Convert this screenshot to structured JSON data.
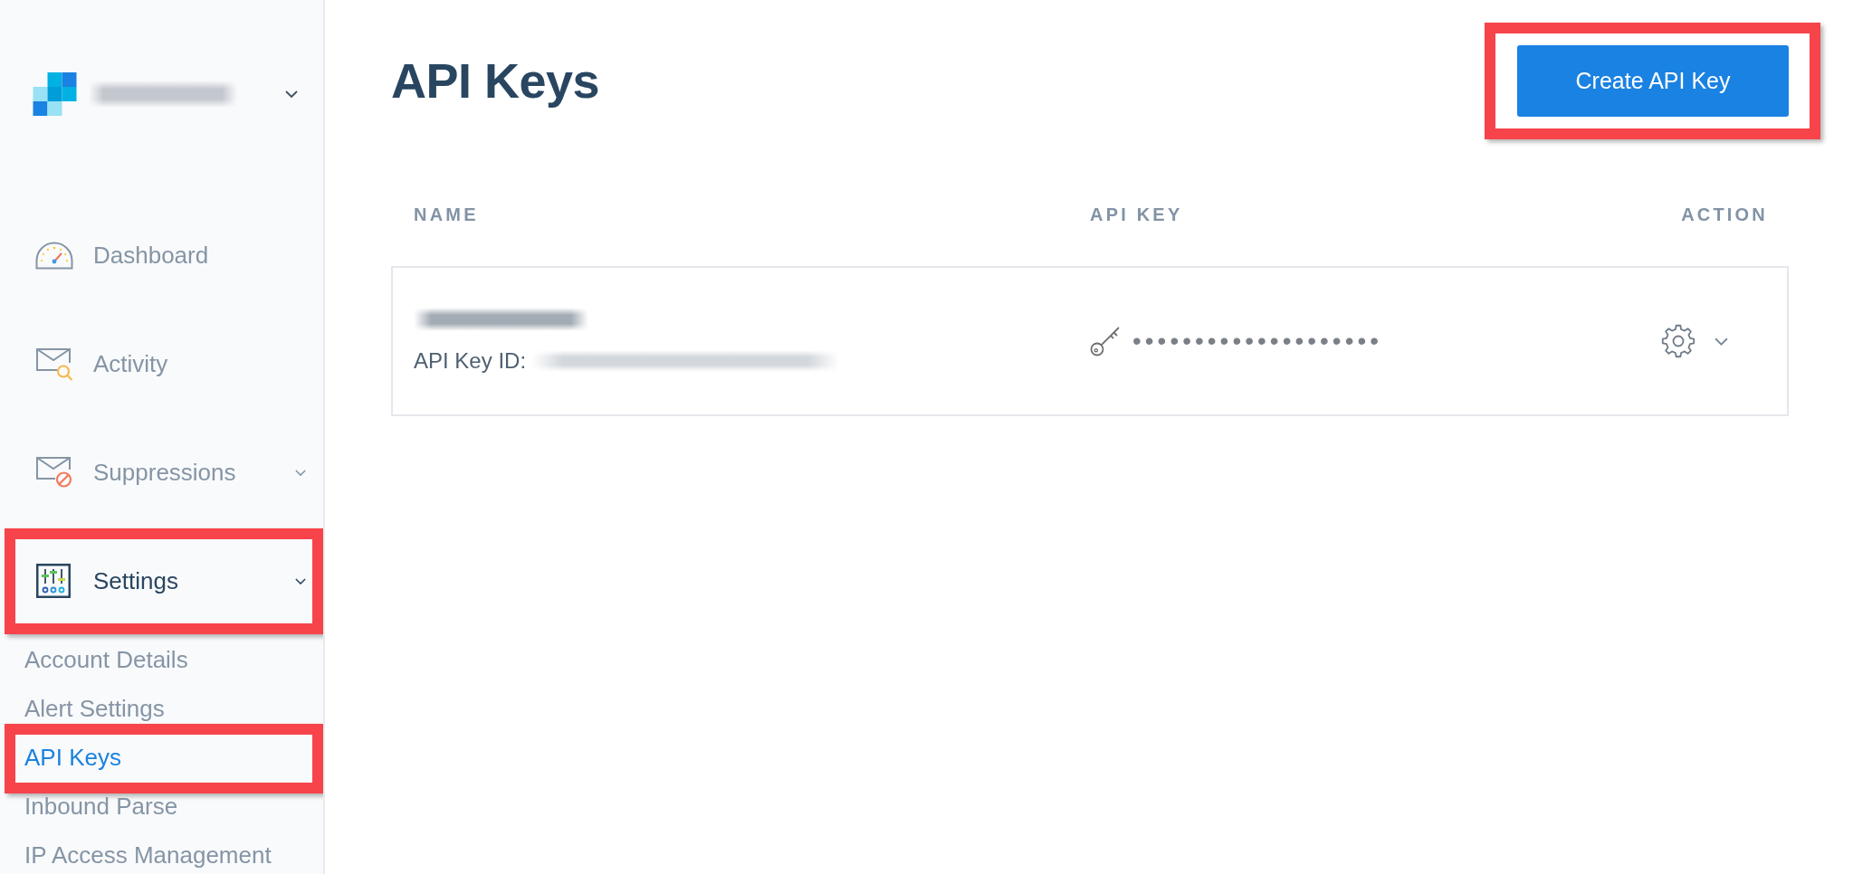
{
  "sidebar": {
    "account": {
      "name_redacted": true
    },
    "nav": [
      {
        "label": "Dashboard",
        "kind": "link",
        "selected": false,
        "highlighted": false
      },
      {
        "label": "Activity",
        "kind": "link",
        "selected": false,
        "highlighted": false
      },
      {
        "label": "Suppressions",
        "kind": "group",
        "selected": false,
        "highlighted": false
      },
      {
        "label": "Settings",
        "kind": "group",
        "selected": true,
        "highlighted": true,
        "children": [
          {
            "label": "Account Details",
            "selected": false,
            "highlighted": false
          },
          {
            "label": "Alert Settings",
            "selected": false,
            "highlighted": false
          },
          {
            "label": "API Keys",
            "selected": true,
            "highlighted": true
          },
          {
            "label": "Inbound Parse",
            "selected": false,
            "highlighted": false
          },
          {
            "label": "IP Access Management",
            "selected": false,
            "highlighted": false
          }
        ]
      }
    ]
  },
  "page": {
    "title": "API Keys",
    "create_button": {
      "label": "Create API Key",
      "highlighted": true
    }
  },
  "table": {
    "columns": [
      "NAME",
      "API KEY",
      "ACTION"
    ],
    "rows": [
      {
        "name_redacted": true,
        "id_label": "API Key ID:",
        "id_redacted": true,
        "masked_key": "••••••••••••••••••••"
      }
    ]
  }
}
